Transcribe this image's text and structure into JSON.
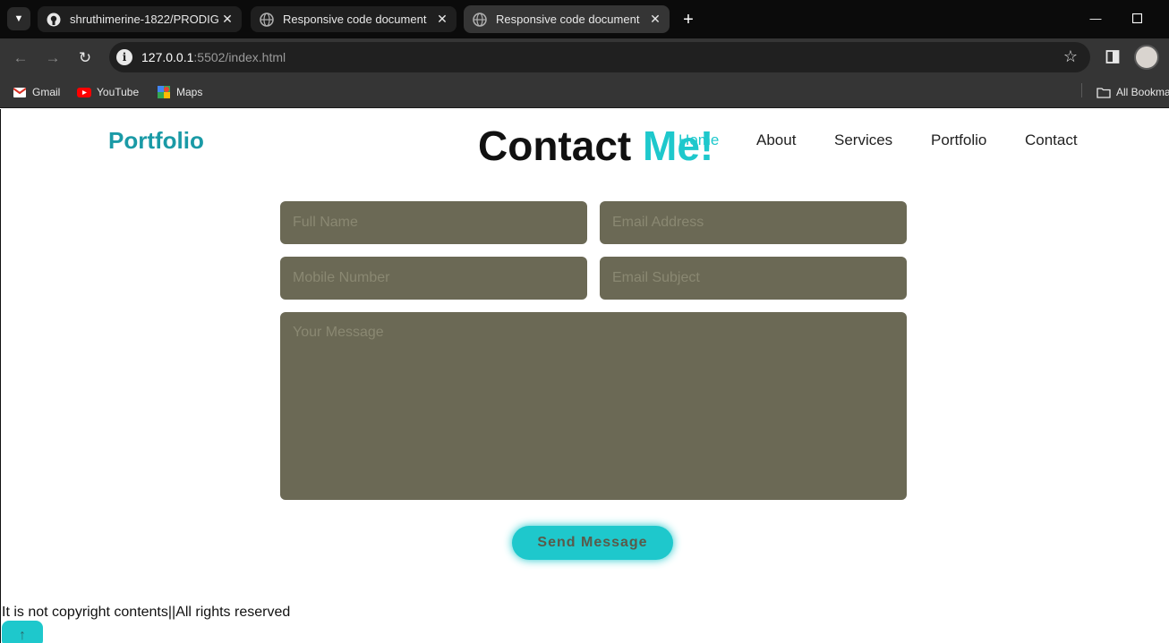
{
  "browser": {
    "tabs": [
      {
        "title": "shruthimerine-1822/PRODIGY_W",
        "icon": "github-icon"
      },
      {
        "title": "Responsive code document",
        "icon": "globe-icon"
      },
      {
        "title": "Responsive code document",
        "icon": "globe-icon",
        "active": true
      }
    ],
    "url": {
      "host": "127.0.0.1",
      "rest": ":5502/index.html"
    },
    "bookmarks": [
      {
        "label": "Gmail",
        "icon": "gmail-icon"
      },
      {
        "label": "YouTube",
        "icon": "youtube-icon"
      },
      {
        "label": "Maps",
        "icon": "maps-icon"
      }
    ],
    "all_bookmarks": "All Bookma"
  },
  "page": {
    "logo": "Portfolio",
    "heading_main": "Contact",
    "heading_accent": "Me!",
    "nav": [
      "Home",
      "About",
      "Services",
      "Portfolio",
      "Contact"
    ],
    "form": {
      "full_name": "Full Name",
      "email": "Email Address",
      "mobile": "Mobile Number",
      "subject": "Email Subject",
      "message": "Your Message",
      "submit": "Send Message"
    },
    "footer": "It is not copyright contents||All rights reserved"
  },
  "colors": {
    "accent": "#1ec8cc",
    "logo": "#1a9aa6",
    "field_bg": "#6b6955"
  }
}
